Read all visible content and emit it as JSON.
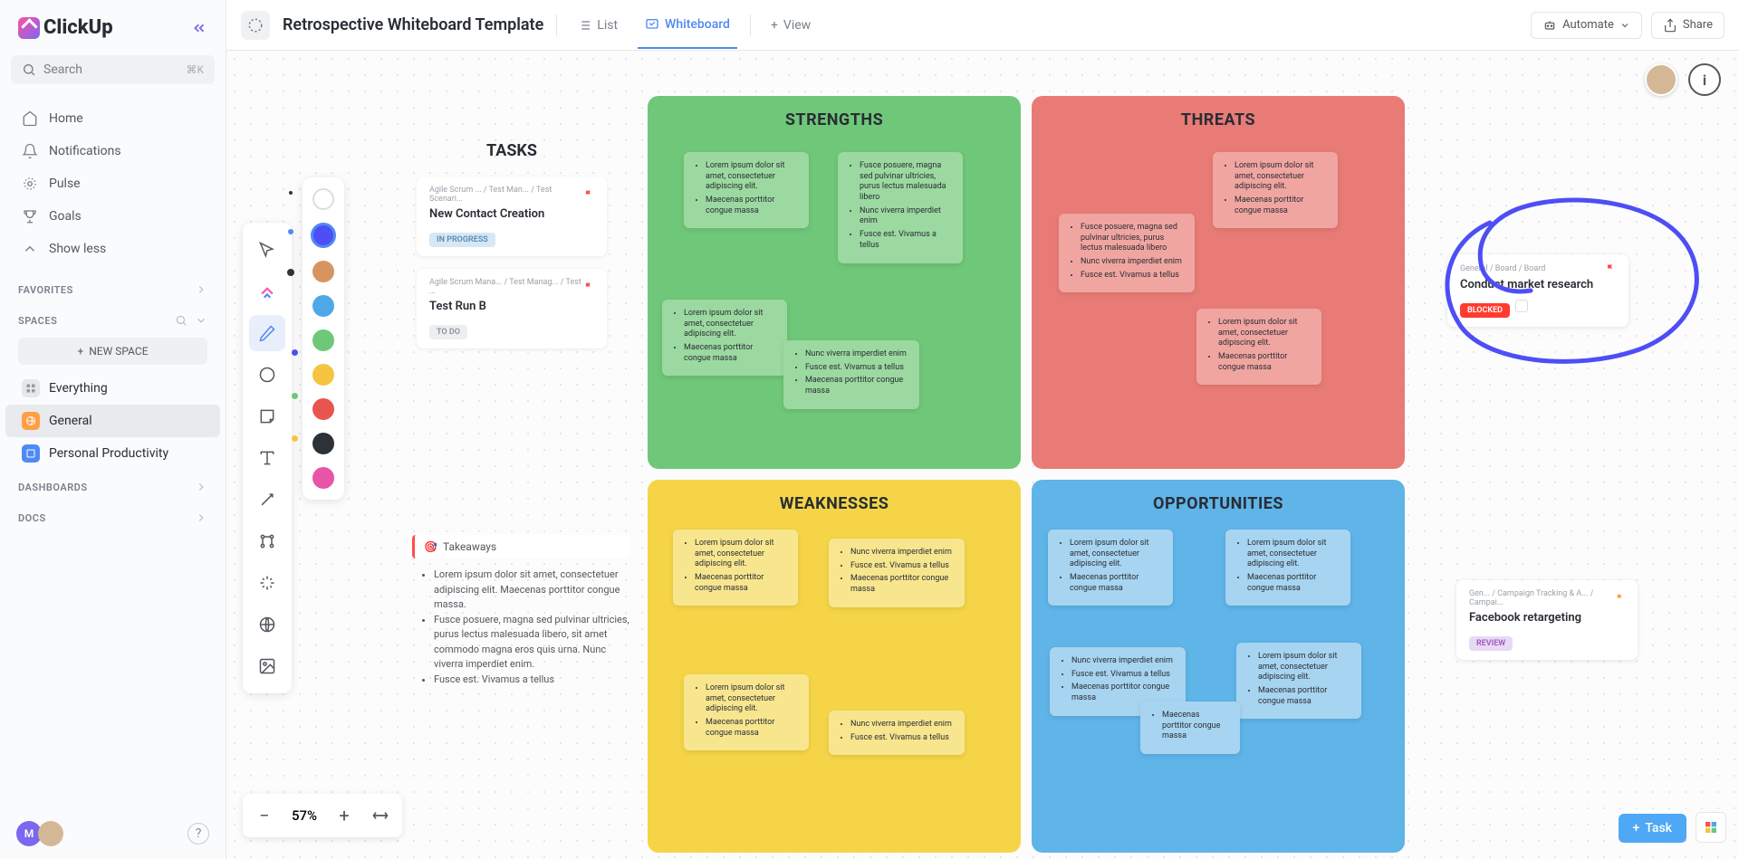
{
  "brand": "ClickUp",
  "search": {
    "placeholder": "Search",
    "shortcut": "⌘K"
  },
  "nav": {
    "home": "Home",
    "notifications": "Notifications",
    "pulse": "Pulse",
    "goals": "Goals",
    "show_less": "Show less"
  },
  "sections": {
    "favorites": "FAVORITES",
    "spaces": "SPACES",
    "dashboards": "DASHBOARDS",
    "docs": "DOCS"
  },
  "new_space": "NEW SPACE",
  "spaces": {
    "everything": "Everything",
    "general": "General",
    "personal": "Personal Productivity"
  },
  "board": {
    "title": "Retrospective Whiteboard Template",
    "views": {
      "list": "List",
      "whiteboard": "Whiteboard",
      "add_view": "View"
    },
    "automate": "Automate",
    "share": "Share"
  },
  "zoom": {
    "percent": "57%"
  },
  "tasks": {
    "title": "TASKS",
    "items": [
      {
        "breadcrumb": "Agile Scrum ...  /  Test Man...  /  Test Scenari...",
        "name": "New Contact Creation",
        "status": "IN PROGRESS",
        "status_class": "progress"
      },
      {
        "breadcrumb": "Agile Scrum Mana...  /  Test Manag...  /  Test ...",
        "name": "Test Run B",
        "status": "TO DO",
        "status_class": "todo"
      }
    ]
  },
  "swot": {
    "strengths": "STRENGTHS",
    "threats": "THREATS",
    "weaknesses": "WEAKNESSES",
    "opportunities": "OPPORTUNITIES"
  },
  "lorem": {
    "a": "Lorem ipsum dolor sit amet, consectetuer adipiscing elit.",
    "b": "Maecenas porttitor congue massa",
    "c": "Fusce posuere, magna sed pulvinar ultricies, purus lectus malesuada libero",
    "d": "Nunc viverra imperdiet enim",
    "e": "Fusce est. Vivamus a tellus"
  },
  "takeaways": {
    "label": "Takeaways",
    "items": [
      "Lorem ipsum dolor sit amet, consectetuer adipiscing elit. Maecenas porttitor congue massa.",
      "Fusce posuere, magna sed pulvinar ultricies, purus lectus malesuada libero, sit amet commodo magna eros quis urna. Nunc viverra imperdiet enim.",
      "Fusce est. Vivamus a tellus"
    ]
  },
  "right_cards": {
    "c1": {
      "breadcrumb": "General  /  Board  /  Board",
      "name": "Conduct market research",
      "status": "BLOCKED",
      "status_class": "blocked"
    },
    "c2": {
      "breadcrumb": "Gen...  /  Campaign Tracking & A...  /  Campai...",
      "name": "Facebook retargeting",
      "status": "REVIEW",
      "status_class": "review"
    }
  },
  "task_btn": "Task",
  "avatar_initial": "M"
}
